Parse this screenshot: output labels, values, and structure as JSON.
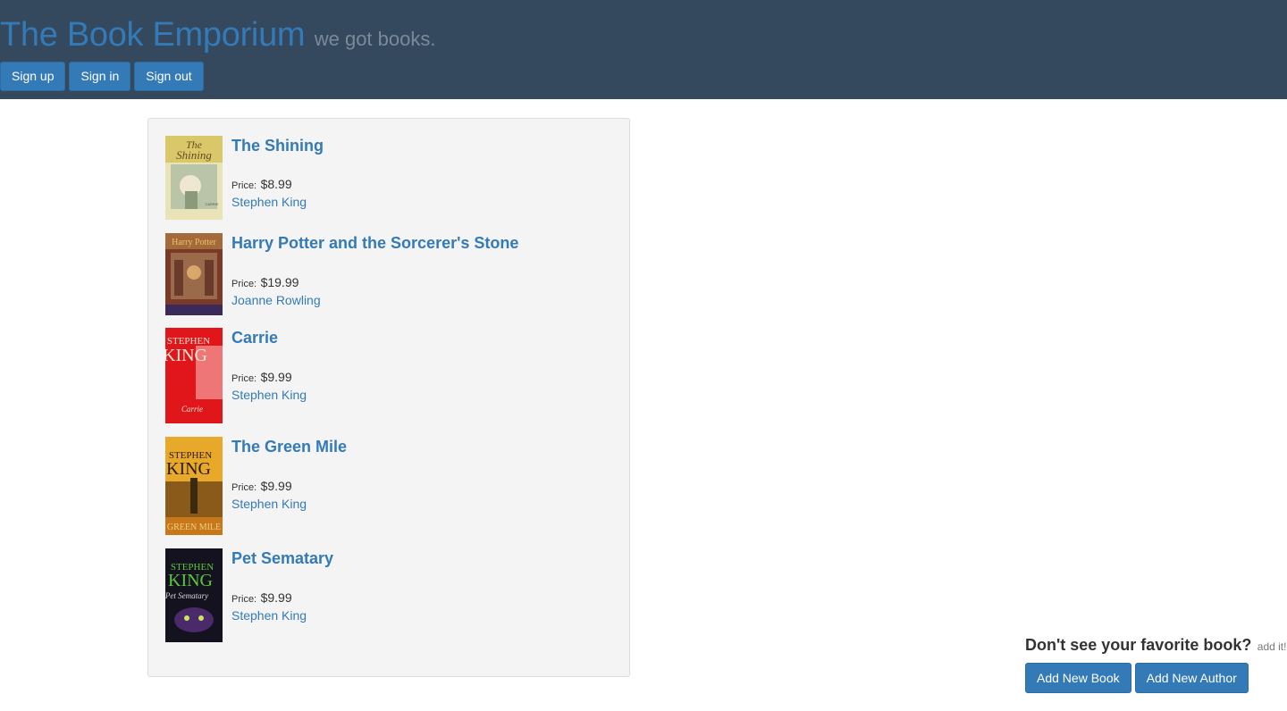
{
  "header": {
    "title": "The Book Emporium",
    "tagline": "we got books.",
    "buttons": {
      "sign_up": "Sign up",
      "sign_in": "Sign in",
      "sign_out": "Sign out"
    }
  },
  "books": [
    {
      "title": "The Shining",
      "price_label": "Price:",
      "price": "$8.99",
      "author": "Stephen King",
      "cover_text": "The Shining Stephen King"
    },
    {
      "title": "Harry Potter and the Sorcerer's Stone",
      "price_label": "Price:",
      "price": "$19.99",
      "author": "Joanne Rowling",
      "cover_text": "Harry Potter"
    },
    {
      "title": "Carrie",
      "price_label": "Price:",
      "price": "$9.99",
      "author": "Stephen King",
      "cover_text": "STEPHEN KING Carrie"
    },
    {
      "title": "The Green Mile",
      "price_label": "Price:",
      "price": "$9.99",
      "author": "Stephen King",
      "cover_text": "STEPHEN KING GREEN MILE"
    },
    {
      "title": "Pet Sematary",
      "price_label": "Price:",
      "price": "$9.99",
      "author": "Stephen King",
      "cover_text": "STEPHEN KING Pet Sematary"
    }
  ],
  "add_section": {
    "question": "Don't see your favorite book?",
    "hint": "add it!",
    "add_book": "Add New Book",
    "add_author": "Add New Author"
  },
  "colors": {
    "header_bg": "#34495e",
    "accent": "#337ab7",
    "panel_bg": "#f4f4f4"
  }
}
